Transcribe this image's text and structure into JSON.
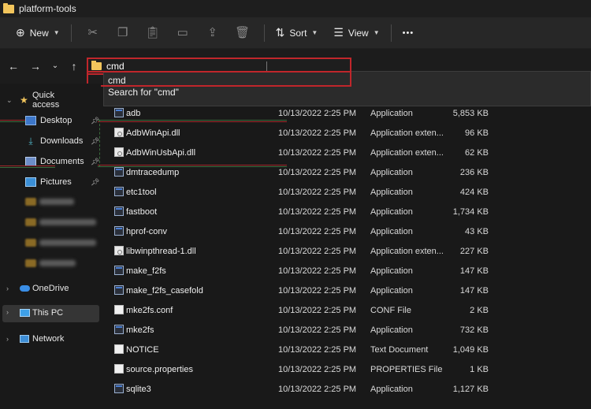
{
  "window": {
    "title": "platform-tools"
  },
  "toolbar": {
    "new_label": "New",
    "sort_label": "Sort",
    "view_label": "View",
    "more_label": "•••"
  },
  "address": {
    "value": "cmd",
    "suggestions": [
      "cmd",
      "Search for \"cmd\""
    ]
  },
  "sidebar": {
    "quick_access": "Quick access",
    "items": [
      "Desktop",
      "Downloads",
      "Documents",
      "Pictures"
    ],
    "onedrive": "OneDrive",
    "thispc": "This PC",
    "network": "Network"
  },
  "files": [
    {
      "name": "adb",
      "date": "10/13/2022 2:25 PM",
      "type": "Application",
      "size": "5,853 KB",
      "icon": "app"
    },
    {
      "name": "AdbWinApi.dll",
      "date": "10/13/2022 2:25 PM",
      "type": "Application exten...",
      "size": "96 KB",
      "icon": "dll"
    },
    {
      "name": "AdbWinUsbApi.dll",
      "date": "10/13/2022 2:25 PM",
      "type": "Application exten...",
      "size": "62 KB",
      "icon": "dll"
    },
    {
      "name": "dmtracedump",
      "date": "10/13/2022 2:25 PM",
      "type": "Application",
      "size": "236 KB",
      "icon": "app"
    },
    {
      "name": "etc1tool",
      "date": "10/13/2022 2:25 PM",
      "type": "Application",
      "size": "424 KB",
      "icon": "app"
    },
    {
      "name": "fastboot",
      "date": "10/13/2022 2:25 PM",
      "type": "Application",
      "size": "1,734 KB",
      "icon": "app"
    },
    {
      "name": "hprof-conv",
      "date": "10/13/2022 2:25 PM",
      "type": "Application",
      "size": "43 KB",
      "icon": "app"
    },
    {
      "name": "libwinpthread-1.dll",
      "date": "10/13/2022 2:25 PM",
      "type": "Application exten...",
      "size": "227 KB",
      "icon": "dll"
    },
    {
      "name": "make_f2fs",
      "date": "10/13/2022 2:25 PM",
      "type": "Application",
      "size": "147 KB",
      "icon": "app"
    },
    {
      "name": "make_f2fs_casefold",
      "date": "10/13/2022 2:25 PM",
      "type": "Application",
      "size": "147 KB",
      "icon": "app"
    },
    {
      "name": "mke2fs.conf",
      "date": "10/13/2022 2:25 PM",
      "type": "CONF File",
      "size": "2 KB",
      "icon": "doc"
    },
    {
      "name": "mke2fs",
      "date": "10/13/2022 2:25 PM",
      "type": "Application",
      "size": "732 KB",
      "icon": "app"
    },
    {
      "name": "NOTICE",
      "date": "10/13/2022 2:25 PM",
      "type": "Text Document",
      "size": "1,049 KB",
      "icon": "doc"
    },
    {
      "name": "source.properties",
      "date": "10/13/2022 2:25 PM",
      "type": "PROPERTIES File",
      "size": "1 KB",
      "icon": "doc"
    },
    {
      "name": "sqlite3",
      "date": "10/13/2022 2:25 PM",
      "type": "Application",
      "size": "1,127 KB",
      "icon": "app"
    }
  ],
  "colors": {
    "highlight_red": "#c0262b",
    "folder": "#f2c55c",
    "background": "#191919"
  }
}
